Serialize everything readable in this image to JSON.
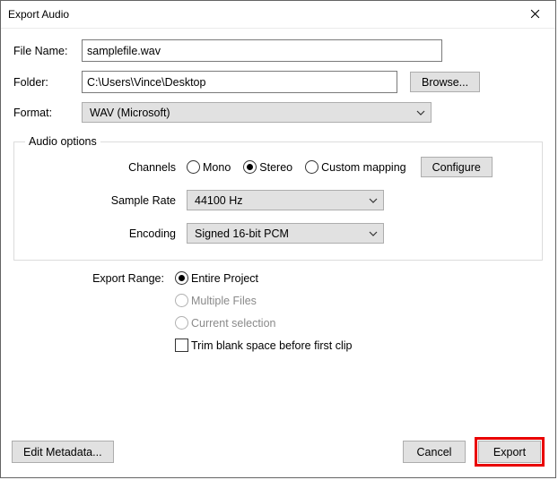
{
  "title": "Export Audio",
  "labels": {
    "filename": "File Name:",
    "folder": "Folder:",
    "format": "Format:",
    "browse": "Browse...",
    "audio_options": "Audio options",
    "channels": "Channels",
    "sample_rate": "Sample Rate",
    "encoding": "Encoding",
    "configure": "Configure",
    "export_range": "Export Range:",
    "trim": "Trim blank space before first clip",
    "edit_metadata": "Edit Metadata...",
    "cancel": "Cancel",
    "export": "Export"
  },
  "values": {
    "filename": "samplefile.wav",
    "folder": "C:\\Users\\Vince\\Desktop",
    "format": "WAV (Microsoft)",
    "sample_rate": "44100 Hz",
    "encoding": "Signed 16-bit PCM"
  },
  "channels": {
    "mono": "Mono",
    "stereo": "Stereo",
    "custom": "Custom mapping"
  },
  "range": {
    "entire": "Entire Project",
    "multiple": "Multiple Files",
    "current": "Current selection"
  }
}
